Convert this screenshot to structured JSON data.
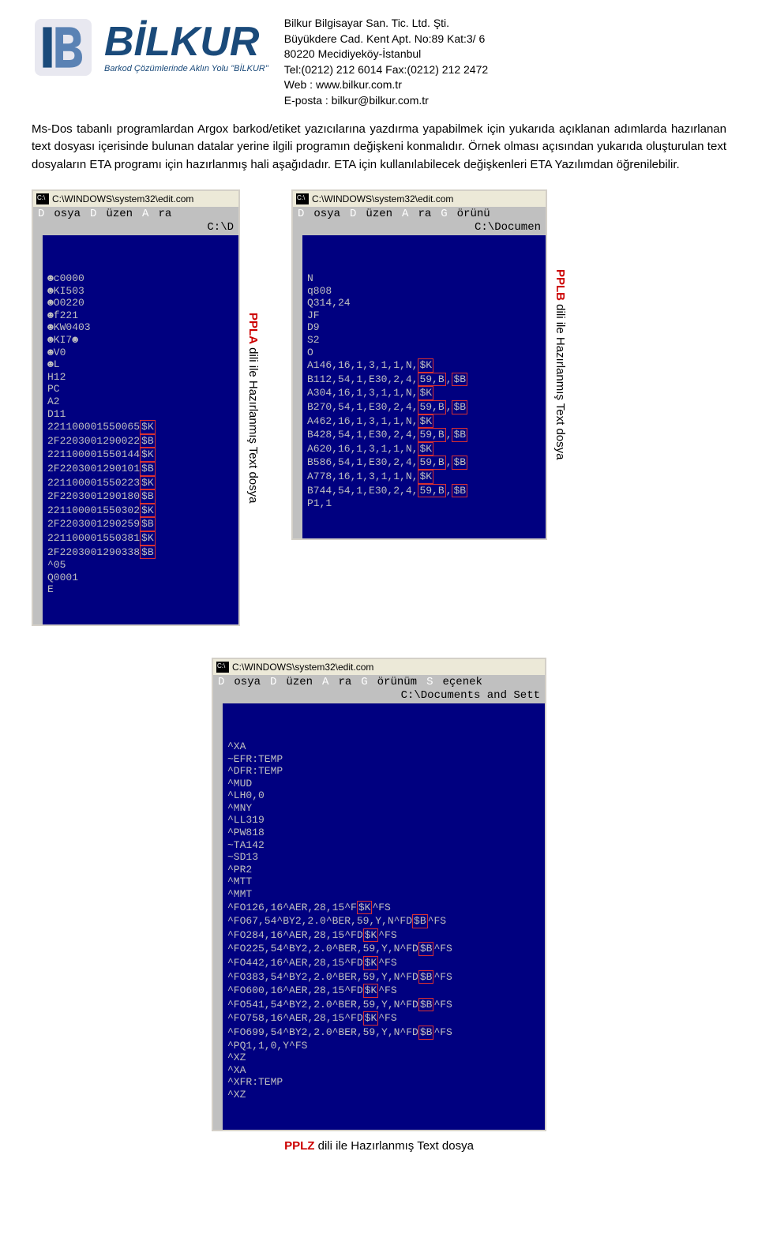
{
  "header": {
    "brand": "BİLKUR",
    "tagline": "Barkod Çözümlerinde Aklın Yolu \"BİLKUR\"",
    "company": [
      "Bilkur Bilgisayar San. Tic. Ltd. Şti.",
      "Büyükdere Cad. Kent Apt. No:89 Kat:3/ 6",
      "80220 Mecidiyeköy-İstanbul",
      "Tel:(0212) 212 6014 Fax:(0212) 212 2472",
      "Web      : www.bilkur.com.tr",
      "E-posta : bilkur@bilkur.com.tr"
    ]
  },
  "paragraph": "Ms-Dos tabanlı programlardan Argox barkod/etiket yazıcılarına yazdırma yapabilmek için yukarıda açıklanan adımlarda hazırlanan text dosyası içerisinde bulunan datalar yerine ilgili programın değişkeni konmalıdır. Örnek olması açısından yukarıda oluşturulan text dosyaların ETA programı için hazırlanmış hali aşağıdadır. ETA için kullanılabilecek değişkenleri ETA Yazılımdan öğrenilebilir.",
  "ppla": {
    "title": "C:\\WINDOWS\\system32\\edit.com",
    "menu": [
      "Dosya",
      "Düzen",
      "Ara"
    ],
    "path": "C:\\D",
    "label_red": "PPLA",
    "label_rest": " dili ile Hazırlanmış Text dosya",
    "lines_pre": [
      "☻c0000",
      "☻KI503",
      "☻O0220",
      "☻f221",
      "☻KW0403",
      "☻KI7☻",
      "☻V0",
      "☻L",
      "H12",
      "PC",
      "A2",
      "D11"
    ],
    "lines_boxed": [
      {
        "pre": "221100001550065",
        "box": "$K"
      },
      {
        "pre": "2F2203001290022",
        "box": "$B"
      },
      {
        "pre": "221100001550144",
        "box": "$K"
      },
      {
        "pre": "2F2203001290101",
        "box": "$B"
      },
      {
        "pre": "221100001550223",
        "box": "$K"
      },
      {
        "pre": "2F2203001290180",
        "box": "$B"
      },
      {
        "pre": "221100001550302",
        "box": "$K"
      },
      {
        "pre": "2F2203001290259",
        "box": "$B"
      },
      {
        "pre": "221100001550381",
        "box": "$K"
      },
      {
        "pre": "2F2203001290338",
        "box": "$B"
      }
    ],
    "lines_post": [
      "^05",
      "Q0001",
      "E"
    ]
  },
  "pplb": {
    "title": "C:\\WINDOWS\\system32\\edit.com",
    "menu": [
      "Dosya",
      "Düzen",
      "Ara",
      "Görünü"
    ],
    "path": "C:\\Documen",
    "label_red": "PPLB",
    "label_rest": " dili ile Hazırlanmış Text dosya",
    "lines_pre": [
      "N",
      "q808",
      "Q314,24",
      "JF",
      "D9",
      "S2",
      "O"
    ],
    "lines_boxed": [
      {
        "pre": "A146,16,1,3,1,1,N,",
        "box": "$K",
        "post": ""
      },
      {
        "pre": "B112,54,1,E30,2,4,",
        "box": "59,B",
        "post": ",",
        "box2": "$B"
      },
      {
        "pre": "A304,16,1,3,1,1,N,",
        "box": "$K",
        "post": ""
      },
      {
        "pre": "B270,54,1,E30,2,4,",
        "box": "59,B",
        "post": ",",
        "box2": "$B"
      },
      {
        "pre": "A462,16,1,3,1,1,N,",
        "box": "$K",
        "post": ""
      },
      {
        "pre": "B428,54,1,E30,2,4,",
        "box": "59,B",
        "post": ",",
        "box2": "$B"
      },
      {
        "pre": "A620,16,1,3,1,1,N,",
        "box": "$K",
        "post": ""
      },
      {
        "pre": "B586,54,1,E30,2,4,",
        "box": "59,B",
        "post": ",",
        "box2": "$B"
      },
      {
        "pre": "A778,16,1,3,1,1,N,",
        "box": "$K",
        "post": ""
      },
      {
        "pre": "B744,54,1,E30,2,4,",
        "box": "59,B",
        "post": ",",
        "box2": "$B"
      }
    ],
    "lines_post": [
      "P1,1"
    ]
  },
  "pplz": {
    "title": "C:\\WINDOWS\\system32\\edit.com",
    "menu": [
      "Dosya",
      "Düzen",
      "Ara",
      "Görünüm",
      "Seçenek"
    ],
    "path": "C:\\Documents and Sett",
    "label_red": "PPLZ",
    "label_rest": " dili ile Hazırlanmış Text dosya",
    "lines_pre": [
      "^XA",
      "~EFR:TEMP",
      "^DFR:TEMP",
      "^MUD",
      "^LH0,0",
      "^MNY",
      "^LL319",
      "^PW818",
      "~TA142",
      "~SD13",
      "^PR2",
      "^MTT",
      "^MMT"
    ],
    "lines_boxed": [
      {
        "pre": "^FO126,16^AER,28,15^F",
        "box": "$K",
        "post": "^FS"
      },
      {
        "pre": "^FO67,54^BY2,2.0^BER,59,Y,N^FD",
        "box": "$B",
        "post": "^FS"
      },
      {
        "pre": "^FO284,16^AER,28,15^FD",
        "box": "$K",
        "post": "^FS"
      },
      {
        "pre": "^FO225,54^BY2,2.0^BER,59,Y,N^FD",
        "box": "$B",
        "post": "^FS"
      },
      {
        "pre": "^FO442,16^AER,28,15^FD",
        "box": "$K",
        "post": "^FS"
      },
      {
        "pre": "^FO383,54^BY2,2.0^BER,59,Y,N^FD",
        "box": "$B",
        "post": "^FS"
      },
      {
        "pre": "^FO600,16^AER,28,15^FD",
        "box": "$K",
        "post": "^FS"
      },
      {
        "pre": "^FO541,54^BY2,2.0^BER,59,Y,N^FD",
        "box": "$B",
        "post": "^FS"
      },
      {
        "pre": "^FO758,16^AER,28,15^FD",
        "box": "$K",
        "post": "^FS"
      },
      {
        "pre": "^FO699,54^BY2,2.0^BER,59,Y,N^FD",
        "box": "$B",
        "post": "^FS"
      }
    ],
    "lines_post": [
      "^PQ1,1,0,Y^FS",
      "^XZ",
      "^XA",
      "^XFR:TEMP",
      "^XZ"
    ]
  }
}
